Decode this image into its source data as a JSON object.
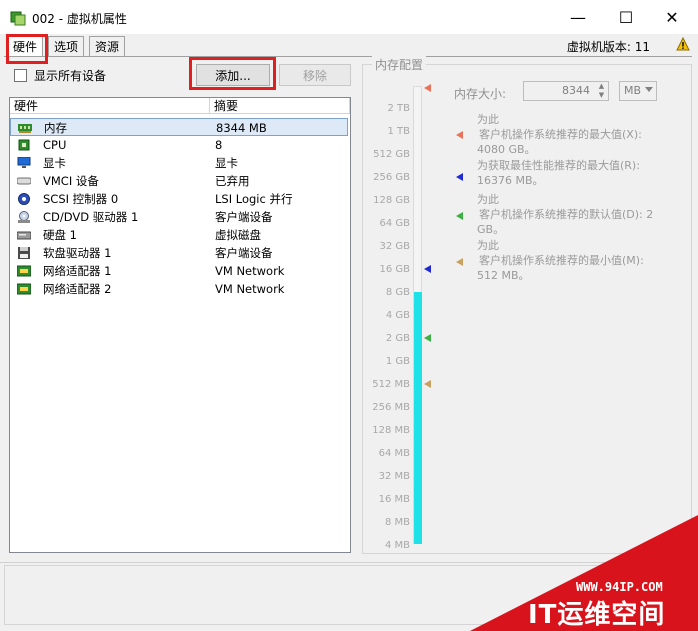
{
  "window": {
    "title": "002 - 虚拟机属性",
    "minimize_glyph": "—",
    "maximize_glyph": "☐",
    "close_glyph": "✕"
  },
  "tabs": [
    {
      "label": "硬件",
      "active": true
    },
    {
      "label": "选项",
      "active": false
    },
    {
      "label": "资源",
      "active": false
    }
  ],
  "version_label": "虚拟机版本: 11",
  "show_all_devices": {
    "label": "显示所有设备",
    "checked": false
  },
  "buttons": {
    "add": "添加...",
    "remove": "移除"
  },
  "device_table": {
    "columns": [
      "硬件",
      "摘要"
    ],
    "rows": [
      {
        "name": "内存",
        "summary": "8344 MB",
        "icon": "memory-icon",
        "selected": true
      },
      {
        "name": "CPU",
        "summary": "8",
        "icon": "cpu-icon",
        "selected": false
      },
      {
        "name": "显卡",
        "summary": "显卡",
        "icon": "display-icon",
        "selected": false
      },
      {
        "name": "VMCI 设备",
        "summary": "已弃用",
        "icon": "vmci-icon",
        "selected": false
      },
      {
        "name": "SCSI 控制器 0",
        "summary": "LSI Logic 并行",
        "icon": "scsi-icon",
        "selected": false
      },
      {
        "name": "CD/DVD 驱动器 1",
        "summary": "客户端设备",
        "icon": "cd-dvd-icon",
        "selected": false
      },
      {
        "name": "硬盘 1",
        "summary": "虚拟磁盘",
        "icon": "hard-disk-icon",
        "selected": false
      },
      {
        "name": "软盘驱动器 1",
        "summary": "客户端设备",
        "icon": "floppy-icon",
        "selected": false
      },
      {
        "name": "网络适配器 1",
        "summary": "VM Network",
        "icon": "network-icon",
        "selected": false
      },
      {
        "name": "网络适配器 2",
        "summary": "VM Network",
        "icon": "network-icon",
        "selected": false
      }
    ]
  },
  "memory_config": {
    "group_title": "内存配置",
    "size_label": "内存大小:",
    "size_value": "8344",
    "unit": "MB",
    "scale": [
      "2 TB",
      "1 TB",
      "512 GB",
      "256 GB",
      "128 GB",
      "64 GB",
      "32 GB",
      "16 GB",
      "8 GB",
      "4 GB",
      "2 GB",
      "1 GB",
      "512 MB",
      "256 MB",
      "128 MB",
      "64 MB",
      "32 MB",
      "16 MB",
      "8 MB",
      "4 MB"
    ],
    "legend": [
      {
        "title": "为此",
        "text": "客户机操作系统推荐的最大值(X):",
        "value": "4080 GB。",
        "color": "#e8735a"
      },
      {
        "title": "",
        "text": "为获取最佳性能推荐的最大值(R):",
        "value": "16376 MB。",
        "color": "#1f2bd0"
      },
      {
        "title": "为此",
        "text": "客户机操作系统推荐的默认值(D): 2",
        "value": "GB。",
        "color": "#3cb043"
      },
      {
        "title": "为此",
        "text": "客户机操作系统推荐的最小值(M):",
        "value": "512 MB。",
        "color": "#c8a060"
      }
    ]
  },
  "watermark": {
    "url": "WWW.94IP.COM",
    "brand": "IT运维空间"
  },
  "colors": {
    "accent_red": "#e02020",
    "memory_fill": "#1ee2e8",
    "selection": "#dde9f7"
  }
}
